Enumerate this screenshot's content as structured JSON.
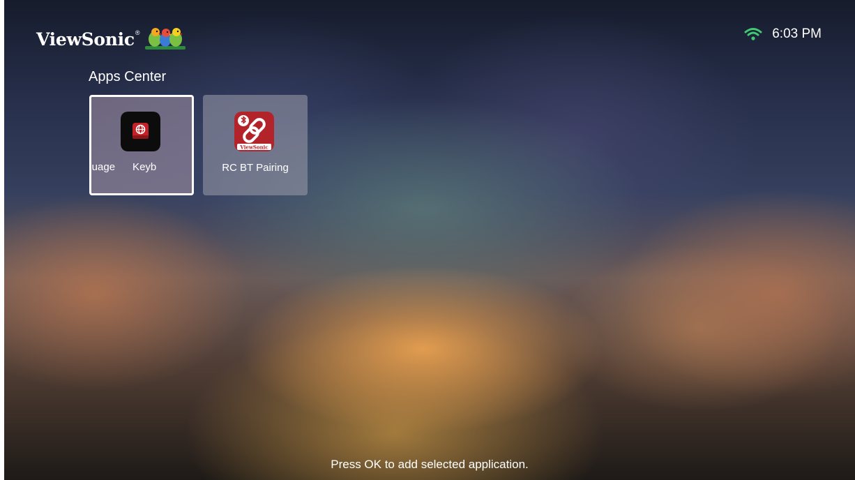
{
  "brand": {
    "name": "ViewSonic",
    "registered_mark": "®"
  },
  "status_bar": {
    "wifi_icon": "wifi-icon",
    "wifi_color": "#3ecb72",
    "time": "6:03 PM"
  },
  "apps_center": {
    "title": "Apps Center",
    "apps": [
      {
        "label": "Language Keyboard",
        "visible_text": "nguage      Keyb",
        "icon": "language-keyboard-icon",
        "selected": true
      },
      {
        "label": "RC BT Pairing",
        "icon": "rc-bt-pairing-icon",
        "icon_caption": "ViewSonic",
        "selected": false
      }
    ]
  },
  "hint": "Press OK to add selected application.",
  "colors": {
    "accent_red": "#c32228",
    "selection_border": "#ffffff"
  }
}
